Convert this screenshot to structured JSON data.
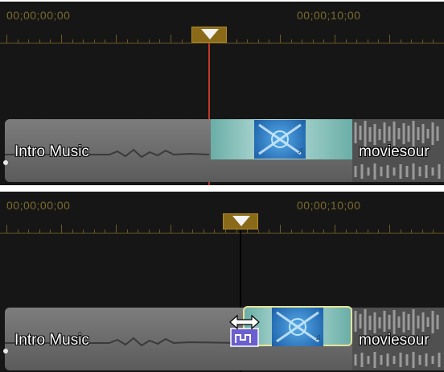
{
  "panels": [
    {
      "timecode_start": "00;00;00;00",
      "timecode_mid": "00;00;10;00",
      "track_label": "Intro Music",
      "next_clip_label": "moviesour",
      "playhead_color": "#c0392b",
      "state": "before-drag"
    },
    {
      "timecode_start": "00;00;00;00",
      "timecode_mid": "00;00;10;00",
      "track_label": "Intro Music",
      "next_clip_label": "moviesour",
      "playhead_color": "#000000",
      "state": "dragging-transition"
    }
  ],
  "icons": {
    "playhead": "playhead-icon",
    "transition_thumbnail": "transition-thumbnail-icon",
    "music_note": "music-note-icon",
    "resize_cursor": "horizontal-resize-cursor-icon"
  },
  "colors": {
    "timeline_bg": "#161616",
    "ruler": "#6b5a24",
    "timecode_text": "#7a6a2c",
    "track": "#6a6a6a",
    "clip_highlight": "#9fd3cc",
    "selection_outline": "#e6e39a"
  }
}
